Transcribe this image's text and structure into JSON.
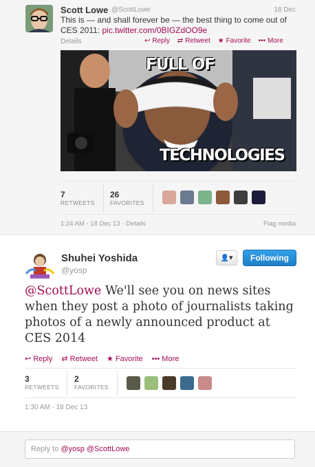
{
  "tweet1": {
    "name": "Scott Lowe",
    "handle": "@ScottLowe",
    "date": "18 Dec",
    "text_before": "This is — and shall forever be — the best thing to come out of CES 2011: ",
    "link": "pic.twitter.com/0BIGZdOO9e",
    "details": "Details",
    "actions": {
      "reply": "Reply",
      "retweet": "Retweet",
      "favorite": "Favorite",
      "more": "More"
    },
    "photo_caption_top": "FULL OF",
    "photo_caption_bottom": "TECHNOLOGIES",
    "retweets": "7",
    "retweets_label": "RETWEETS",
    "favorites": "26",
    "favorites_label": "FAVORITES",
    "timestamp": "1:24 AM - 18 Dec 13 · Details",
    "flag": "Flag media"
  },
  "tweet2": {
    "name": "Shuhei Yoshida",
    "handle": "@yosp",
    "follow_label": "Following",
    "user_menu_glyph": "▾",
    "mention": "@ScottLowe",
    "text_rest": " We'll see you on news sites when they post a photo of journalists taking photos of a newly announced product at CES 2014",
    "actions": {
      "reply": "Reply",
      "retweet": "Retweet",
      "favorite": "Favorite",
      "more": "More"
    },
    "retweets": "3",
    "retweets_label": "RETWEETS",
    "favorites": "2",
    "favorites_label": "FAVORITES",
    "timestamp": "1:30 AM - 18 Dec 13"
  },
  "reply": {
    "prefix": "Reply to ",
    "mentions": "@yosp @ScottLowe"
  },
  "icons": {
    "reply": "↩",
    "retweet": "⇄",
    "favorite": "★",
    "more": "•••",
    "user": "👤"
  },
  "colors": {
    "link": "#a30c53",
    "follow": "#2b93dc"
  }
}
